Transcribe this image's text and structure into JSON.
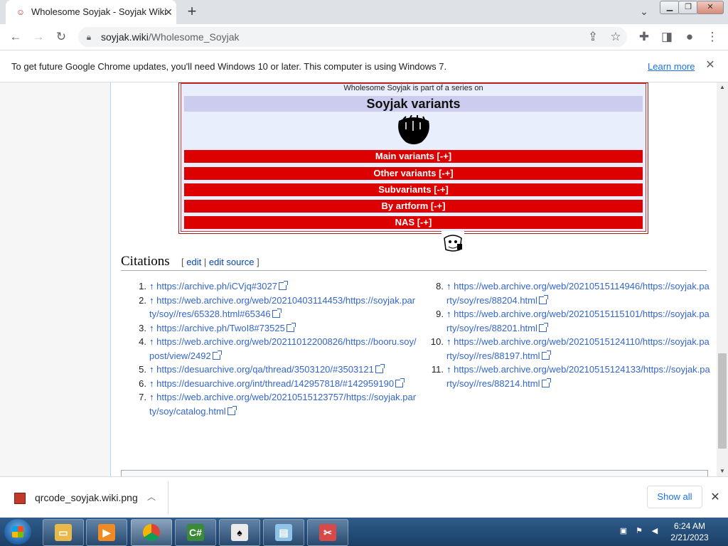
{
  "browser": {
    "tab_title": "Wholesome Soyjak - Soyjak Wiki",
    "url_domain": "soyjak.wiki",
    "url_path": "/Wholesome_Soyjak",
    "infobar_message": "To get future Google Chrome updates, you'll need Windows 10 or later. This computer is using Windows 7.",
    "infobar_link": "Learn more"
  },
  "navbox": {
    "series_text": "Wholesome Soyjak is part of a series on",
    "title": "Soyjak variants",
    "rows": [
      "Main variants [-+]",
      "Other variants [-+]",
      "Subvariants [-+]",
      "By artform [-+]",
      "NAS [-+]"
    ]
  },
  "citations": {
    "heading": "Citations",
    "edit_open": "[",
    "edit": "edit",
    "edit_sep": "|",
    "edit_source": "edit source",
    "edit_close": "]",
    "arrow": "↑",
    "left": [
      {
        "num": "1.",
        "url": "https://archive.ph/iCVjq#3027"
      },
      {
        "num": "2.",
        "url": "https://web.archive.org/web/20210403114453/https://soyjak.party/soy//res/65328.html#65346"
      },
      {
        "num": "3.",
        "url": "https://archive.ph/TwoI8#73525"
      },
      {
        "num": "4.",
        "url": "https://web.archive.org/web/20211012200826/https://booru.soy/post/view/2492"
      },
      {
        "num": "5.",
        "url": "https://desuarchive.org/qa/thread/3503120/#3503121"
      },
      {
        "num": "6.",
        "url": "https://desuarchive.org/int/thread/142957818/#142959190"
      },
      {
        "num": "7.",
        "url": "https://web.archive.org/web/20210515123757/https://soyjak.party/soy/catalog.html"
      }
    ],
    "right": [
      {
        "num": "8.",
        "url": "https://web.archive.org/web/20210515114946/https://soyjak.party/soy/res/88204.html"
      },
      {
        "num": "9.",
        "url": "https://web.archive.org/web/20210515115101/https://soyjak.party/soy/res/88201.html"
      },
      {
        "num": "10.",
        "url": "https://web.archive.org/web/20210515124110/https://soyjak.party/soy//res/88197.html"
      },
      {
        "num": "11.",
        "url": "https://web.archive.org/web/20210515124133/https://soyjak.party/soy//res/88214.html"
      }
    ]
  },
  "download": {
    "filename": "qrcode_soyjak.wiki.png",
    "show_all": "Show all"
  },
  "taskbar": {
    "time": "6:24 AM",
    "date": "2/21/2023"
  },
  "colors": {
    "navbox_row": "#dd0000",
    "link": "#3366cc",
    "chrome_accent": "#1a73e8"
  }
}
